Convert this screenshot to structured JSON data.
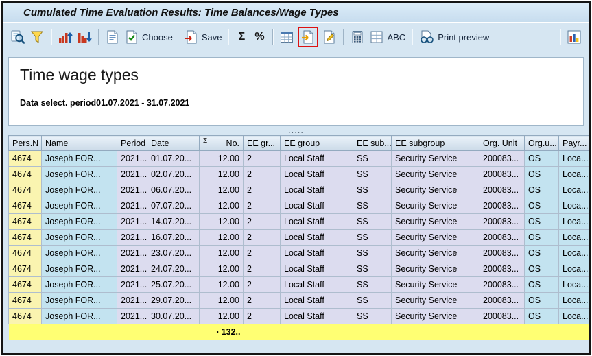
{
  "window": {
    "title": "Cumulated Time Evaluation Results: Time Balances/Wage Types"
  },
  "colors": {
    "window_bg": "#d6e6f2",
    "highlight_box": "#dd1111",
    "total_row": "#ffff73",
    "pers_cell": "#faf4b0",
    "name_cell": "#c3e3f0",
    "data_cell": "#dcdcef"
  },
  "toolbar": {
    "choose_label": "Choose",
    "save_label": "Save",
    "sum_glyph": "Σ",
    "subtotal_glyph": "%",
    "abc_label": "ABC",
    "print_preview_label": "Print preview",
    "icons": [
      "choose-detail-icon",
      "filter-icon",
      "sort-ascending-icon",
      "sort-descending-icon",
      "display-list-icon",
      "choose-icon",
      "save-icon",
      "sum-icon",
      "subtotal-icon",
      "spreadsheet-icon",
      "export-icon",
      "word-processing-icon",
      "calculator-icon",
      "abc-analysis-icon",
      "print-preview-icon",
      "graphic-icon"
    ],
    "highlighted_icon": "export-icon"
  },
  "report": {
    "title": "Time wage types",
    "period_label": "Data select. period",
    "period_value": "01.07.2021 - 31.07.2021",
    "splitter_dots": "....."
  },
  "table": {
    "headers": {
      "pers": "Pers.N",
      "name": "Name",
      "period": "Period",
      "date": "Date",
      "sigma": "Σ",
      "no": "No.",
      "ee_gr": "EE gr...",
      "ee_group": "EE group",
      "ee_sub": "EE sub...",
      "ee_subgroup": "EE subgroup",
      "org_unit": "Org. Unit",
      "org_u": "Org.u...",
      "payr": "Payr..."
    },
    "rows": [
      {
        "pers": "4674",
        "name": "Joseph FOR...",
        "period": "2021...",
        "date": "01.07.20...",
        "no": "12.00",
        "ee_gr": "2",
        "ee_group": "Local Staff",
        "ee_sub": "SS",
        "ee_subgroup": "Security Service",
        "org_unit": "200083...",
        "org_u": "OS",
        "payr": "Loca..."
      },
      {
        "pers": "4674",
        "name": "Joseph FOR...",
        "period": "2021...",
        "date": "02.07.20...",
        "no": "12.00",
        "ee_gr": "2",
        "ee_group": "Local Staff",
        "ee_sub": "SS",
        "ee_subgroup": "Security Service",
        "org_unit": "200083...",
        "org_u": "OS",
        "payr": "Loca..."
      },
      {
        "pers": "4674",
        "name": "Joseph FOR...",
        "period": "2021...",
        "date": "06.07.20...",
        "no": "12.00",
        "ee_gr": "2",
        "ee_group": "Local Staff",
        "ee_sub": "SS",
        "ee_subgroup": "Security Service",
        "org_unit": "200083...",
        "org_u": "OS",
        "payr": "Loca..."
      },
      {
        "pers": "4674",
        "name": "Joseph FOR...",
        "period": "2021...",
        "date": "07.07.20...",
        "no": "12.00",
        "ee_gr": "2",
        "ee_group": "Local Staff",
        "ee_sub": "SS",
        "ee_subgroup": "Security Service",
        "org_unit": "200083...",
        "org_u": "OS",
        "payr": "Loca..."
      },
      {
        "pers": "4674",
        "name": "Joseph FOR...",
        "period": "2021...",
        "date": "14.07.20...",
        "no": "12.00",
        "ee_gr": "2",
        "ee_group": "Local Staff",
        "ee_sub": "SS",
        "ee_subgroup": "Security Service",
        "org_unit": "200083...",
        "org_u": "OS",
        "payr": "Loca..."
      },
      {
        "pers": "4674",
        "name": "Joseph FOR...",
        "period": "2021...",
        "date": "16.07.20...",
        "no": "12.00",
        "ee_gr": "2",
        "ee_group": "Local Staff",
        "ee_sub": "SS",
        "ee_subgroup": "Security Service",
        "org_unit": "200083...",
        "org_u": "OS",
        "payr": "Loca..."
      },
      {
        "pers": "4674",
        "name": "Joseph FOR...",
        "period": "2021...",
        "date": "23.07.20...",
        "no": "12.00",
        "ee_gr": "2",
        "ee_group": "Local Staff",
        "ee_sub": "SS",
        "ee_subgroup": "Security Service",
        "org_unit": "200083...",
        "org_u": "OS",
        "payr": "Loca..."
      },
      {
        "pers": "4674",
        "name": "Joseph FOR...",
        "period": "2021...",
        "date": "24.07.20...",
        "no": "12.00",
        "ee_gr": "2",
        "ee_group": "Local Staff",
        "ee_sub": "SS",
        "ee_subgroup": "Security Service",
        "org_unit": "200083...",
        "org_u": "OS",
        "payr": "Loca..."
      },
      {
        "pers": "4674",
        "name": "Joseph FOR...",
        "period": "2021...",
        "date": "25.07.20...",
        "no": "12.00",
        "ee_gr": "2",
        "ee_group": "Local Staff",
        "ee_sub": "SS",
        "ee_subgroup": "Security Service",
        "org_unit": "200083...",
        "org_u": "OS",
        "payr": "Loca..."
      },
      {
        "pers": "4674",
        "name": "Joseph FOR...",
        "period": "2021...",
        "date": "29.07.20...",
        "no": "12.00",
        "ee_gr": "2",
        "ee_group": "Local Staff",
        "ee_sub": "SS",
        "ee_subgroup": "Security Service",
        "org_unit": "200083...",
        "org_u": "OS",
        "payr": "Loca..."
      },
      {
        "pers": "4674",
        "name": "Joseph FOR...",
        "period": "2021...",
        "date": "30.07.20...",
        "no": "12.00",
        "ee_gr": "2",
        "ee_group": "Local Staff",
        "ee_sub": "SS",
        "ee_subgroup": "Security Service",
        "org_unit": "200083...",
        "org_u": "OS",
        "payr": "Loca..."
      }
    ],
    "total": {
      "marker": "▪",
      "value": "132.."
    }
  }
}
